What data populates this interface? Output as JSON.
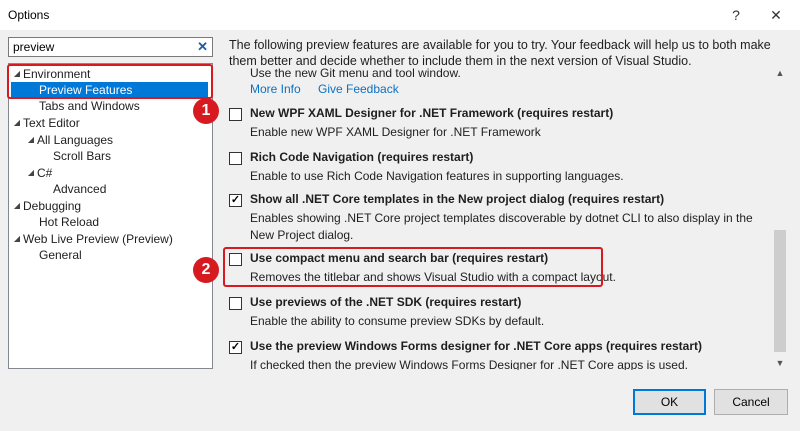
{
  "window": {
    "title": "Options",
    "help_label": "?",
    "close_label": "✕"
  },
  "search": {
    "value": "preview",
    "clear_icon": "✕"
  },
  "tree": {
    "items": [
      {
        "label": "Environment",
        "arrow": "◢"
      },
      {
        "label": "Preview Features"
      },
      {
        "label": "Tabs and Windows"
      },
      {
        "label": "Text Editor",
        "arrow": "◢"
      },
      {
        "label": "All Languages",
        "arrow": "◢"
      },
      {
        "label": "Scroll Bars"
      },
      {
        "label": "C#",
        "arrow": "◢"
      },
      {
        "label": "Advanced"
      },
      {
        "label": "Debugging",
        "arrow": "◢"
      },
      {
        "label": "Hot Reload"
      },
      {
        "label": "Web Live Preview (Preview)",
        "arrow": "◢"
      },
      {
        "label": "General"
      }
    ]
  },
  "annotations": {
    "badge1": "1",
    "badge2": "2",
    "color": "#d71920"
  },
  "description": "The following preview features are available for you to try. Your feedback will help us to both make them better and decide whether to include them in the next version of Visual Studio.",
  "partial_text": "Use the new Git menu and tool window.",
  "links": {
    "more_info": "More Info",
    "give_feedback": "Give Feedback"
  },
  "features": [
    {
      "title": "New WPF XAML Designer for .NET Framework (requires restart)",
      "description": "Enable new WPF XAML Designer for .NET Framework",
      "checked": false
    },
    {
      "title": "Rich Code Navigation (requires restart)",
      "description": "Enable to use Rich Code Navigation features in supporting languages.",
      "checked": false
    },
    {
      "title": "Show all .NET Core templates in the New project dialog (requires restart)",
      "description": "Enables showing .NET Core project templates discoverable by dotnet CLI to also display in the New Project dialog.",
      "checked": true
    },
    {
      "title": "Use compact menu and search bar (requires restart)",
      "description": "Removes the titlebar and shows Visual Studio with a compact layout.",
      "checked": false
    },
    {
      "title": "Use previews of the .NET SDK (requires restart)",
      "description": "Enable the ability to consume preview SDKs by default.",
      "checked": false
    },
    {
      "title": "Use the preview Windows Forms designer for .NET Core apps (requires restart)",
      "description": "If checked then the preview Windows Forms Designer for .NET Core apps is used.",
      "checked": true
    }
  ],
  "buttons": {
    "ok": "OK",
    "cancel": "Cancel"
  },
  "colors": {
    "selection": "#0078d7",
    "link": "#0e70c0",
    "background": "#f0f0f0"
  }
}
